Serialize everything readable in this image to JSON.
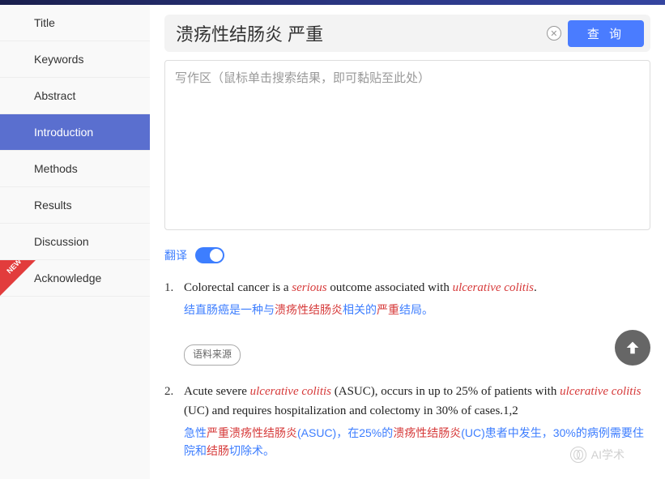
{
  "sidebar": {
    "items": [
      {
        "label": "Title"
      },
      {
        "label": "Keywords"
      },
      {
        "label": "Abstract"
      },
      {
        "label": "Introduction"
      },
      {
        "label": "Methods"
      },
      {
        "label": "Results"
      },
      {
        "label": "Discussion"
      },
      {
        "label": "Acknowledge"
      }
    ],
    "active_index": 3,
    "new_badge_text": "NEW"
  },
  "search": {
    "value": "溃疡性结肠炎 严重",
    "query_button": "查 询"
  },
  "write_area": {
    "placeholder": "写作区（鼠标单击搜索结果，即可黏贴至此处）"
  },
  "translate": {
    "label": "翻译",
    "on": true
  },
  "results": [
    {
      "num": "1.",
      "en_parts": [
        {
          "t": "Colorectal cancer is a ",
          "c": ""
        },
        {
          "t": "serious",
          "c": "hl-red-it"
        },
        {
          "t": " outcome associated with ",
          "c": ""
        },
        {
          "t": "ulcerative colitis",
          "c": "hl-red-it"
        },
        {
          "t": ".",
          "c": ""
        }
      ],
      "cn_parts": [
        {
          "t": "结直肠癌是一种与",
          "c": ""
        },
        {
          "t": "溃疡性结肠炎",
          "c": "hl"
        },
        {
          "t": "相关的",
          "c": ""
        },
        {
          "t": "严重",
          "c": "hl"
        },
        {
          "t": "结局。",
          "c": ""
        }
      ],
      "source_label": "语料来源"
    },
    {
      "num": "2.",
      "en_parts": [
        {
          "t": "Acute severe ",
          "c": ""
        },
        {
          "t": "ulcerative colitis",
          "c": "hl-red-it"
        },
        {
          "t": " (ASUC), occurs in up to 25% of patients with ",
          "c": ""
        },
        {
          "t": "ulcerative colitis",
          "c": "hl-red-it"
        },
        {
          "t": " (UC) and requires hospitalization and colectomy in 30% of cases.1,2",
          "c": ""
        }
      ],
      "cn_parts": [
        {
          "t": "急性",
          "c": ""
        },
        {
          "t": "严重溃疡性结肠炎",
          "c": "hl"
        },
        {
          "t": "(ASUC)，在25%的",
          "c": ""
        },
        {
          "t": "溃疡性结肠炎",
          "c": "hl"
        },
        {
          "t": "(UC)患者中发生，30%的病例需要住院和",
          "c": ""
        },
        {
          "t": "结肠",
          "c": "hl"
        },
        {
          "t": "切除术。",
          "c": ""
        }
      ]
    }
  ],
  "watermark": "AI学术"
}
